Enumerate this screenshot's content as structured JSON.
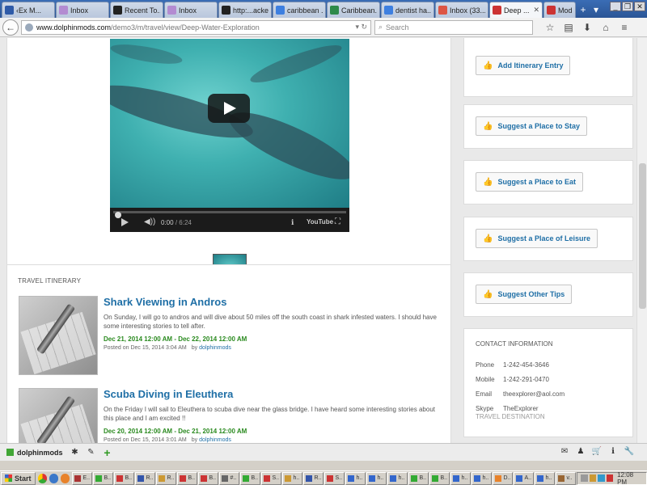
{
  "browser": {
    "tabs": [
      {
        "label": "‹Ex M...",
        "color": "#2e5aa8"
      },
      {
        "label": "Inbox",
        "color": "#b38bd1"
      },
      {
        "label": "Recent To...",
        "color": "#222"
      },
      {
        "label": "Inbox",
        "color": "#b38bd1"
      },
      {
        "label": "http:...acker",
        "color": "#222"
      },
      {
        "label": "caribbean ...",
        "color": "#3d7fe0"
      },
      {
        "label": "Caribbean...",
        "color": "#2e8a4a"
      },
      {
        "label": "dentist ha...",
        "color": "#3d7fe0"
      },
      {
        "label": "Inbox (33...",
        "color": "#d54"
      },
      {
        "label": "Deep ...",
        "color": "#c33",
        "active": true
      },
      {
        "label": "Mod",
        "color": "#c33"
      }
    ],
    "new_tab": "+",
    "tab_list": "▾",
    "url_host": "www.dolphinmods.com",
    "url_path": "/demo3/m/travel/view/Deep-Water-Exploration",
    "search_placeholder": "Search",
    "nav_icons": {
      "back": "←",
      "star": "☆",
      "reader": "▤",
      "download": "⬇",
      "home": "⌂",
      "menu": "≡"
    }
  },
  "video": {
    "time_current": "0:00",
    "time_duration": "6:24",
    "youtube_logo": "YouTube"
  },
  "itinerary": {
    "heading": "TRAVEL ITINERARY",
    "entries": [
      {
        "title": "Shark Viewing in Andros",
        "description": "On Sunday, I will go to andros and will dive about 50 miles off the south coast in shark infested waters. I should have some interesting stories to tell after.",
        "dates": "Dec 21, 2014 12:00 AM - Dec 22, 2014 12:00 AM",
        "posted": "Posted on Dec 15, 2014 3:04 AM",
        "by": "by",
        "author": "dolphinmods"
      },
      {
        "title": "Scuba Diving in Eleuthera",
        "description": "On the Friday I will sail to Eleuthera to scuba dive near the glass bridge. I have heard some interesting stories about this place and I am excited !!",
        "dates": "Dec 20, 2014 12:00 AM - Dec 21, 2014 12:00 AM",
        "posted": "Posted on Dec 15, 2014 3:01 AM",
        "by": "by",
        "author": "dolphinmods"
      }
    ]
  },
  "sidebar": {
    "buttons": [
      {
        "label": "Add Itinerary Entry"
      },
      {
        "label": "Suggest a Place to Stay"
      },
      {
        "label": "Suggest a Place to Eat"
      },
      {
        "label": "Suggest a Place of Leisure"
      },
      {
        "label": "Suggest Other Tips"
      }
    ],
    "contact": {
      "heading": "CONTACT INFORMATION",
      "rows": [
        {
          "label": "Phone",
          "value": "1-242-454-3646"
        },
        {
          "label": "Mobile",
          "value": "1-242-291-0470"
        },
        {
          "label": "Email",
          "value": "theexplorer@aol.com"
        },
        {
          "label": "Skype",
          "value": "TheExplorer"
        }
      ]
    },
    "destination_heading": "TRAVEL DESTINATION"
  },
  "addon_bar": {
    "username": "dolphinmods",
    "icons": {
      "gear": "✱",
      "edit": "✎",
      "plus": "+",
      "mail": "✉",
      "user": "♟",
      "cart": "🛒",
      "info": "ℹ",
      "wrench": "🔧"
    }
  },
  "taskbar": {
    "start_label": "Start",
    "items": [
      "E..",
      "B..",
      "B..",
      "R..",
      "R..",
      "B..",
      "B..",
      "#..",
      "B..",
      "S..",
      "h..",
      "R..",
      "S..",
      "h..",
      "h..",
      "h..",
      "B..",
      "B..",
      "h..",
      "h..",
      "D..",
      "A..",
      "h..",
      "v.."
    ],
    "clock": "12:08 PM"
  }
}
